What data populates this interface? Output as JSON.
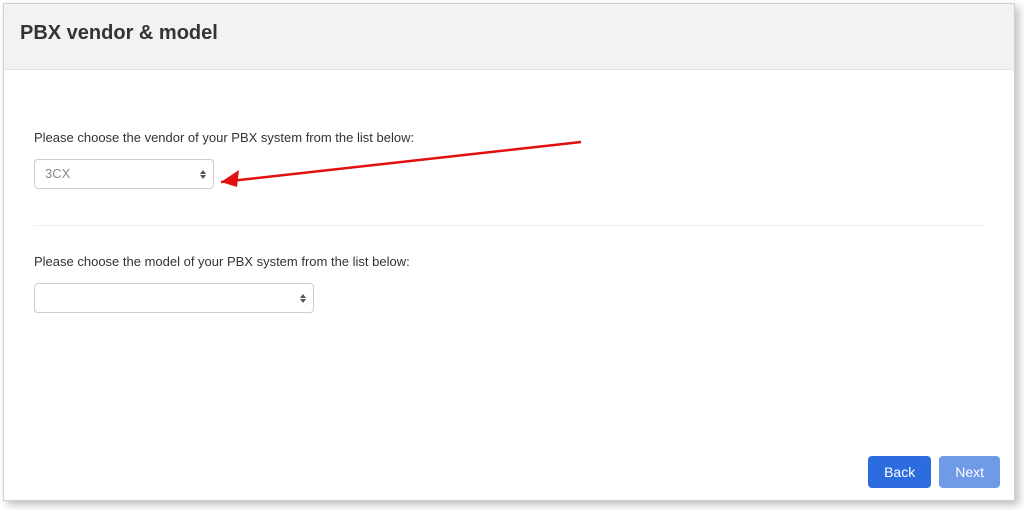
{
  "header": {
    "title": "PBX vendor & model"
  },
  "vendor": {
    "label": "Please choose the vendor of your PBX system from the list below:",
    "selected": "3CX"
  },
  "model": {
    "label": "Please choose the model of your PBX system from the list below:",
    "selected": ""
  },
  "footer": {
    "back_label": "Back",
    "next_label": "Next"
  },
  "colors": {
    "arrow": "#e20f0f"
  }
}
